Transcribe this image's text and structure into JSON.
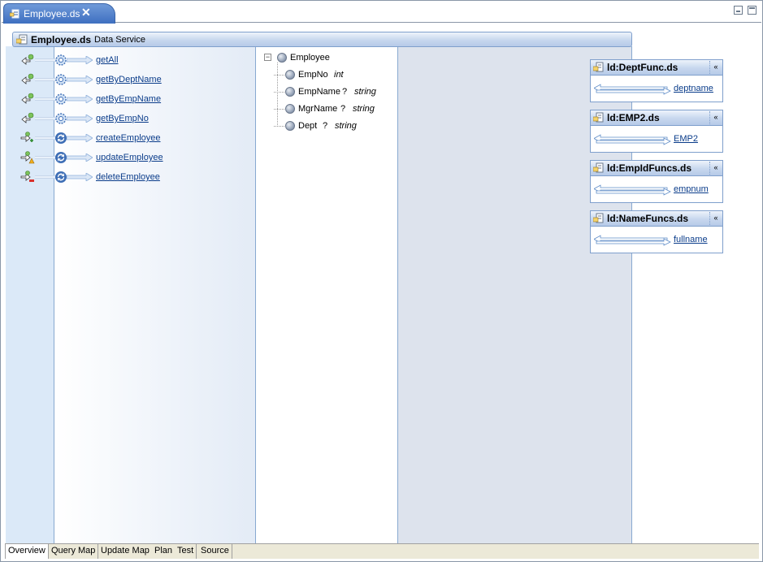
{
  "editor_tab": {
    "title": "Employee.ds",
    "close": "✕"
  },
  "service": {
    "name": "Employee.ds",
    "type": "Data Service"
  },
  "operations": [
    {
      "name": "getAll",
      "kind": "read"
    },
    {
      "name": "getByDeptName",
      "kind": "read"
    },
    {
      "name": "getByEmpName",
      "kind": "read"
    },
    {
      "name": "getByEmpNo",
      "kind": "read"
    },
    {
      "name": "createEmployee",
      "kind": "create"
    },
    {
      "name": "updateEmployee",
      "kind": "update"
    },
    {
      "name": "deleteEmployee",
      "kind": "delete"
    }
  ],
  "tree": {
    "root": {
      "label": "Employee",
      "expander": "−"
    },
    "fields": [
      {
        "name": "EmpNo",
        "optional": "",
        "type": "int"
      },
      {
        "name": "EmpName",
        "optional": "?",
        "type": "string"
      },
      {
        "name": "MgrName",
        "optional": "?",
        "type": "string"
      },
      {
        "name": "Dept",
        "optional": "?",
        "type": "string"
      }
    ]
  },
  "dependencies": [
    {
      "name": "ld:DeptFunc.ds",
      "function": "deptname",
      "collapse": "«"
    },
    {
      "name": "ld:EMP2.ds",
      "function": "EMP2",
      "collapse": "«"
    },
    {
      "name": "ld:EmpIdFuncs.ds",
      "function": "empnum",
      "collapse": "«"
    },
    {
      "name": "ld:NameFuncs.ds",
      "function": "fullname",
      "collapse": "«"
    }
  ],
  "bottom_tabs": [
    {
      "label": "Overview",
      "active": true
    },
    {
      "label": "Query Map",
      "active": false
    },
    {
      "label": "Update Map",
      "active": false
    },
    {
      "label": "Plan",
      "active": false
    },
    {
      "label": "Test",
      "active": false
    },
    {
      "label": "Source",
      "active": false
    }
  ],
  "colors": {
    "tab_active": "#3e6fc0",
    "link": "#0a3c8a",
    "panel_left": "#dbe9f8",
    "panel_right": "#dde3ed"
  }
}
